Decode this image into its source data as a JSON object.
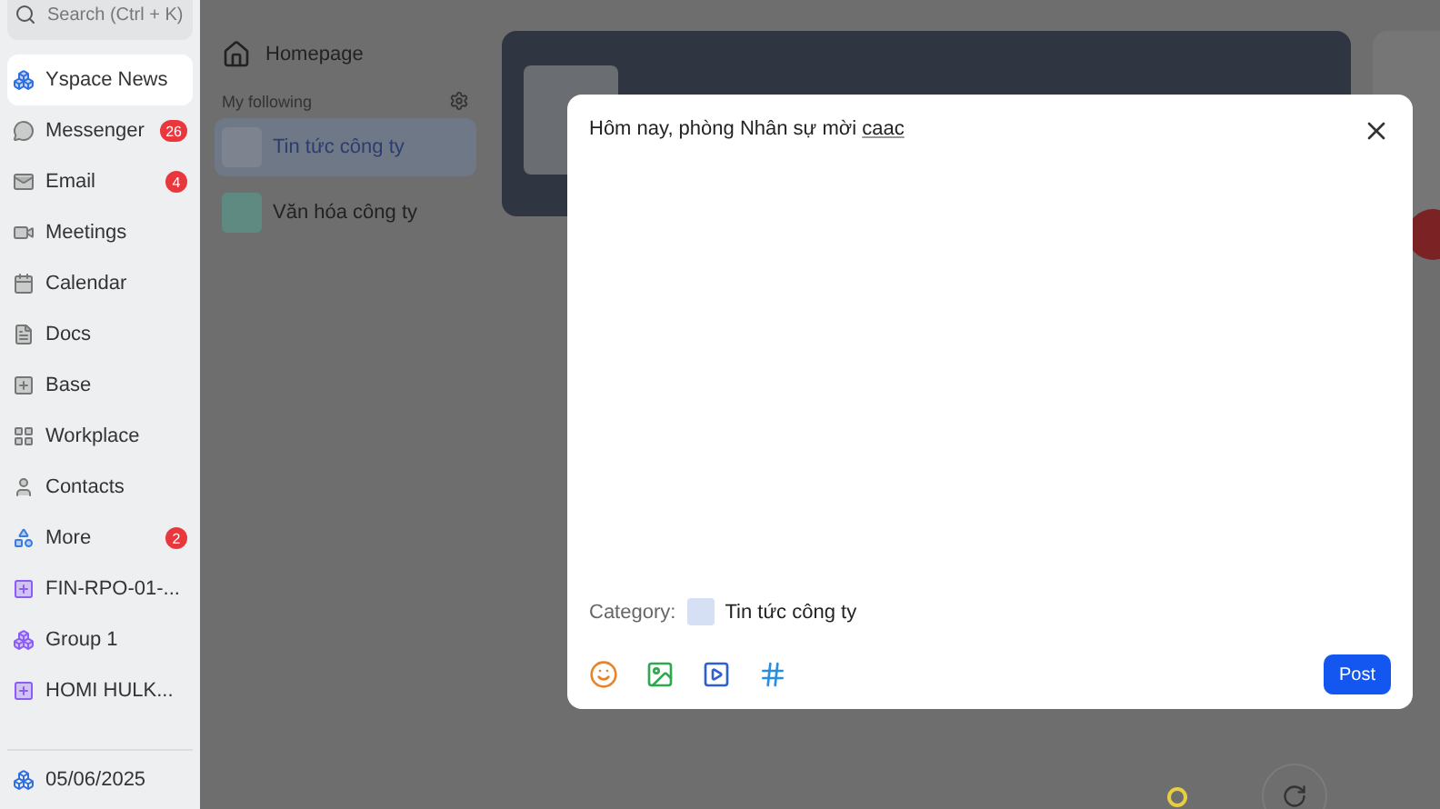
{
  "sidebar": {
    "search": {
      "placeholder": "Search (Ctrl + K)"
    },
    "items": [
      {
        "label": "Yspace News",
        "selected": true
      },
      {
        "label": "Messenger",
        "selected": false,
        "badge": "26"
      },
      {
        "label": "Email",
        "selected": false,
        "badge": "4"
      },
      {
        "label": "Meetings",
        "selected": false
      },
      {
        "label": "Calendar",
        "selected": false
      },
      {
        "label": "Docs",
        "selected": false
      },
      {
        "label": "Base",
        "selected": false
      },
      {
        "label": "Workplace",
        "selected": false
      },
      {
        "label": "Contacts",
        "selected": false
      },
      {
        "label": "More",
        "selected": false,
        "badge": "2"
      },
      {
        "label": "FIN-RPO-01-...",
        "selected": false
      },
      {
        "label": "Group 1",
        "selected": false
      },
      {
        "label": "HOMI HULK...",
        "selected": false
      }
    ],
    "date": "05/06/2025"
  },
  "news_nav": {
    "homepage": "Homepage",
    "following_label": "My following",
    "channels": [
      {
        "label": "Tin tức công ty",
        "selected": true
      },
      {
        "label": "Văn hóa công ty",
        "selected": false
      }
    ]
  },
  "post_dialog": {
    "text": "Hôm nay, phòng Nhân sự mời",
    "misspelled_word": "caac",
    "category_label": "Category:",
    "category": "Tin tức công ty",
    "post_button": "Post"
  }
}
